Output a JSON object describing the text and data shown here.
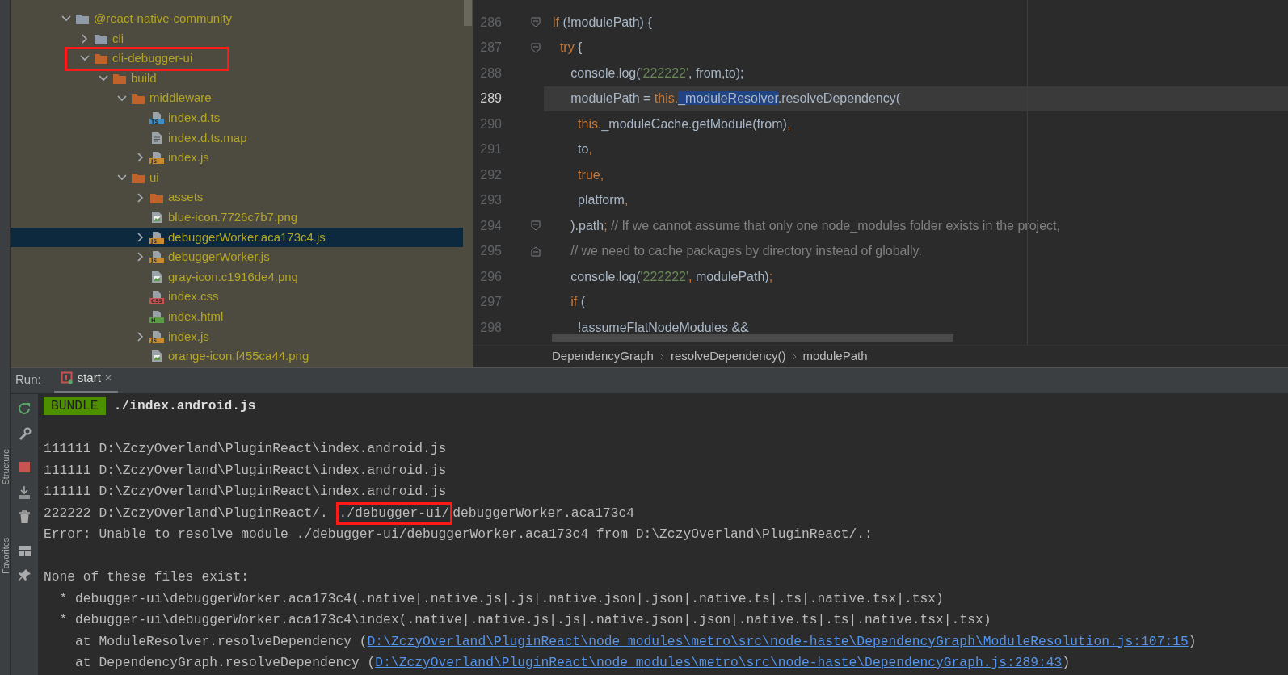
{
  "side_strip": {
    "labels": [
      "Structure",
      "Favorites"
    ]
  },
  "project_tree": {
    "items": [
      {
        "name": "@react-native-community",
        "kind": "module-folder",
        "expanded": true,
        "selected": false,
        "children": [
          {
            "name": "cli",
            "kind": "module-folder",
            "expanded": false,
            "selected": false
          },
          {
            "name": "cli-debugger-ui",
            "kind": "folder",
            "expanded": true,
            "selected": false,
            "children": [
              {
                "name": "build",
                "kind": "folder",
                "expanded": true,
                "selected": false,
                "children": [
                  {
                    "name": "middleware",
                    "kind": "folder",
                    "expanded": true,
                    "selected": false,
                    "children": [
                      {
                        "name": "index.d.ts",
                        "kind": "ts",
                        "icon_label": "TS",
                        "selected": false
                      },
                      {
                        "name": "index.d.ts.map",
                        "kind": "text",
                        "selected": false
                      },
                      {
                        "name": "index.js",
                        "kind": "js",
                        "icon_label": "JS",
                        "expanded": false,
                        "selected": false
                      }
                    ]
                  },
                  {
                    "name": "ui",
                    "kind": "folder",
                    "expanded": true,
                    "selected": false,
                    "children": [
                      {
                        "name": "assets",
                        "kind": "folder",
                        "expanded": false,
                        "selected": false
                      },
                      {
                        "name": "blue-icon.7726c7b7.png",
                        "kind": "image",
                        "selected": false
                      },
                      {
                        "name": "debuggerWorker.aca173c4.js",
                        "kind": "js",
                        "icon_label": "JS",
                        "expanded": false,
                        "selected": true
                      },
                      {
                        "name": "debuggerWorker.js",
                        "kind": "js",
                        "icon_label": "JS",
                        "expanded": false,
                        "selected": false
                      },
                      {
                        "name": "gray-icon.c1916de4.png",
                        "kind": "image",
                        "selected": false
                      },
                      {
                        "name": "index.css",
                        "kind": "css",
                        "icon_label": "CSS",
                        "selected": false
                      },
                      {
                        "name": "index.html",
                        "kind": "html",
                        "icon_label": "H",
                        "selected": false
                      },
                      {
                        "name": "index.js",
                        "kind": "js",
                        "icon_label": "JS",
                        "expanded": false,
                        "selected": false
                      },
                      {
                        "name": "orange-icon.f455ca44.png",
                        "kind": "image",
                        "selected": false
                      }
                    ]
                  }
                ]
              }
            ]
          }
        ]
      }
    ]
  },
  "editor": {
    "lines": [
      {
        "number": "286",
        "fold_open": true,
        "current": false,
        "tokens": [
          {
            "text": "if",
            "kind": "keyword"
          },
          {
            "text": " (!modulePath) {",
            "kind": "plain"
          }
        ]
      },
      {
        "number": "287",
        "fold_open": true,
        "current": false,
        "tokens": [
          {
            "text": "  try",
            "kind": "keyword"
          },
          {
            "text": " {",
            "kind": "plain"
          }
        ]
      },
      {
        "number": "288",
        "current": false,
        "tokens": [
          {
            "text": "     console.log(",
            "kind": "plain"
          },
          {
            "text": "'222222'",
            "kind": "string"
          },
          {
            "text": ", from,to);",
            "kind": "plain"
          }
        ]
      },
      {
        "number": "289",
        "current": true,
        "tokens": [
          {
            "text": "     modulePath = ",
            "kind": "plain"
          },
          {
            "text": "this.",
            "kind": "keyword"
          },
          {
            "text": "_moduleResolver",
            "kind": "selection"
          },
          {
            "text": ".resolveDependency(",
            "kind": "plain"
          }
        ]
      },
      {
        "number": "290",
        "current": false,
        "tokens": [
          {
            "text": "       this",
            "kind": "keyword"
          },
          {
            "text": "._moduleCache.getModule(from)",
            "kind": "plain"
          },
          {
            "text": ",",
            "kind": "keyword"
          }
        ]
      },
      {
        "number": "291",
        "current": false,
        "tokens": [
          {
            "text": "       to",
            "kind": "plain"
          },
          {
            "text": ",",
            "kind": "keyword"
          }
        ]
      },
      {
        "number": "292",
        "current": false,
        "tokens": [
          {
            "text": "       true,",
            "kind": "keyword"
          }
        ]
      },
      {
        "number": "293",
        "current": false,
        "tokens": [
          {
            "text": "       platform",
            "kind": "plain"
          },
          {
            "text": ",",
            "kind": "keyword"
          }
        ]
      },
      {
        "number": "294",
        "fold_open": true,
        "current": false,
        "tokens": [
          {
            "text": "     ).path",
            "kind": "plain"
          },
          {
            "text": ";",
            "kind": "keyword"
          },
          {
            "text": " // If we cannot assume that only one node_modules folder exists in the project,",
            "kind": "comment"
          }
        ]
      },
      {
        "number": "295",
        "fold_close": true,
        "current": false,
        "tokens": [
          {
            "text": "     // we need to cache packages by directory instead of globally.",
            "kind": "comment"
          }
        ]
      },
      {
        "number": "296",
        "current": false,
        "tokens": [
          {
            "text": "     console.log(",
            "kind": "plain"
          },
          {
            "text": "'222222'",
            "kind": "string"
          },
          {
            "text": ",",
            "kind": "keyword"
          },
          {
            "text": " modulePath)",
            "kind": "plain"
          },
          {
            "text": ";",
            "kind": "keyword"
          }
        ]
      },
      {
        "number": "297",
        "current": false,
        "tokens": [
          {
            "text": "     if",
            "kind": "keyword"
          },
          {
            "text": " (",
            "kind": "plain"
          }
        ]
      },
      {
        "number": "298",
        "current": false,
        "tokens": [
          {
            "text": "       !assumeFlatNodeModules &&",
            "kind": "plain"
          }
        ]
      }
    ]
  },
  "breadcrumbs": [
    "DependencyGraph",
    "resolveDependency()",
    "modulePath"
  ],
  "run_panel": {
    "label": "Run:",
    "tabs": [
      {
        "label": "start",
        "selected": true
      }
    ],
    "console": [
      {
        "kind": "badge",
        "badge": "BUNDLE",
        "text": "./index.android.js"
      },
      {
        "kind": "text",
        "gap_before": true,
        "text": "111111 D:\\ZczyOverland\\PluginReact\\index.android.js"
      },
      {
        "kind": "text",
        "text": "111111 D:\\ZczyOverland\\PluginReact\\index.android.js"
      },
      {
        "kind": "text",
        "text": "111111 D:\\ZczyOverland\\PluginReact\\index.android.js"
      },
      {
        "kind": "marked",
        "text": "222222 D:\\ZczyOverland\\PluginReact/. ",
        "marked": "./debugger-ui/",
        "rest": "debuggerWorker.aca173c4"
      },
      {
        "kind": "text",
        "text": "Error: Unable to resolve module ./debugger-ui/debuggerWorker.aca173c4 from D:\\ZczyOverland\\PluginReact/.:"
      },
      {
        "kind": "text",
        "gap_before": true,
        "text": "None of these files exist:"
      },
      {
        "kind": "text",
        "text": "  * debugger-ui\\debuggerWorker.aca173c4(.native|.native.js|.js|.native.json|.json|.native.ts|.ts|.native.tsx|.tsx)"
      },
      {
        "kind": "text",
        "text": "  * debugger-ui\\debuggerWorker.aca173c4\\index(.native|.native.js|.js|.native.json|.json|.native.ts|.ts|.native.tsx|.tsx)"
      },
      {
        "kind": "link",
        "text": "    at ModuleResolver.resolveDependency (",
        "link": "D:\\ZczyOverland\\PluginReact\\node_modules\\metro\\src\\node-haste\\DependencyGraph\\ModuleResolution.js:107:15",
        "suffix": ")"
      },
      {
        "kind": "link",
        "text": "    at DependencyGraph.resolveDependency (",
        "link": "D:\\ZczyOverland\\PluginReact\\node_modules\\metro\\src\\node-haste\\DependencyGraph.js:289:43",
        "suffix": ")"
      }
    ]
  }
}
